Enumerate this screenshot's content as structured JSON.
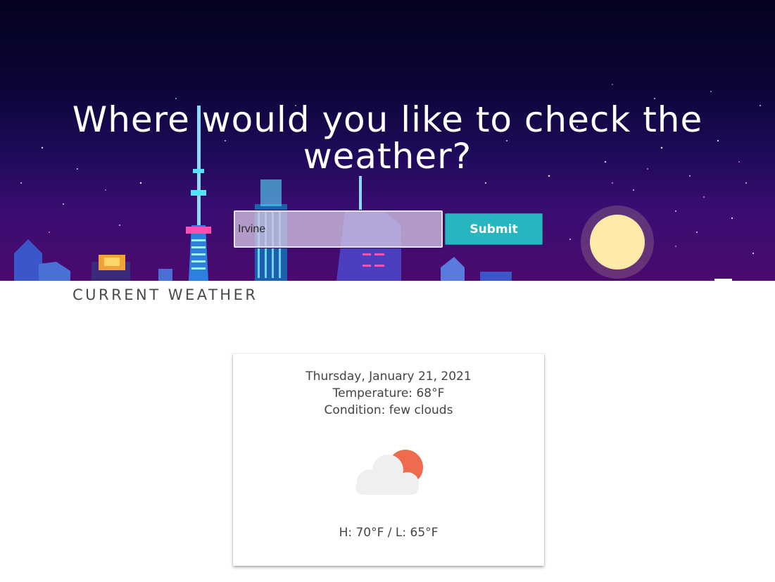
{
  "hero": {
    "title": "Where would you like to check the weather?",
    "search": {
      "value": "Irvine",
      "placeholder": ""
    },
    "submit_label": "Submit"
  },
  "section": {
    "title": "CURRENT WEATHER"
  },
  "weather": {
    "date": "Thursday, January 21, 2021",
    "temperature": "Temperature: 68°F",
    "condition": "Condition: few clouds",
    "icon": "few-clouds-icon",
    "high_low": "H: 70°F / L: 65°F"
  },
  "colors": {
    "accent": "#27b5c0",
    "text": "#444444",
    "sun": "#ee6c4d"
  }
}
